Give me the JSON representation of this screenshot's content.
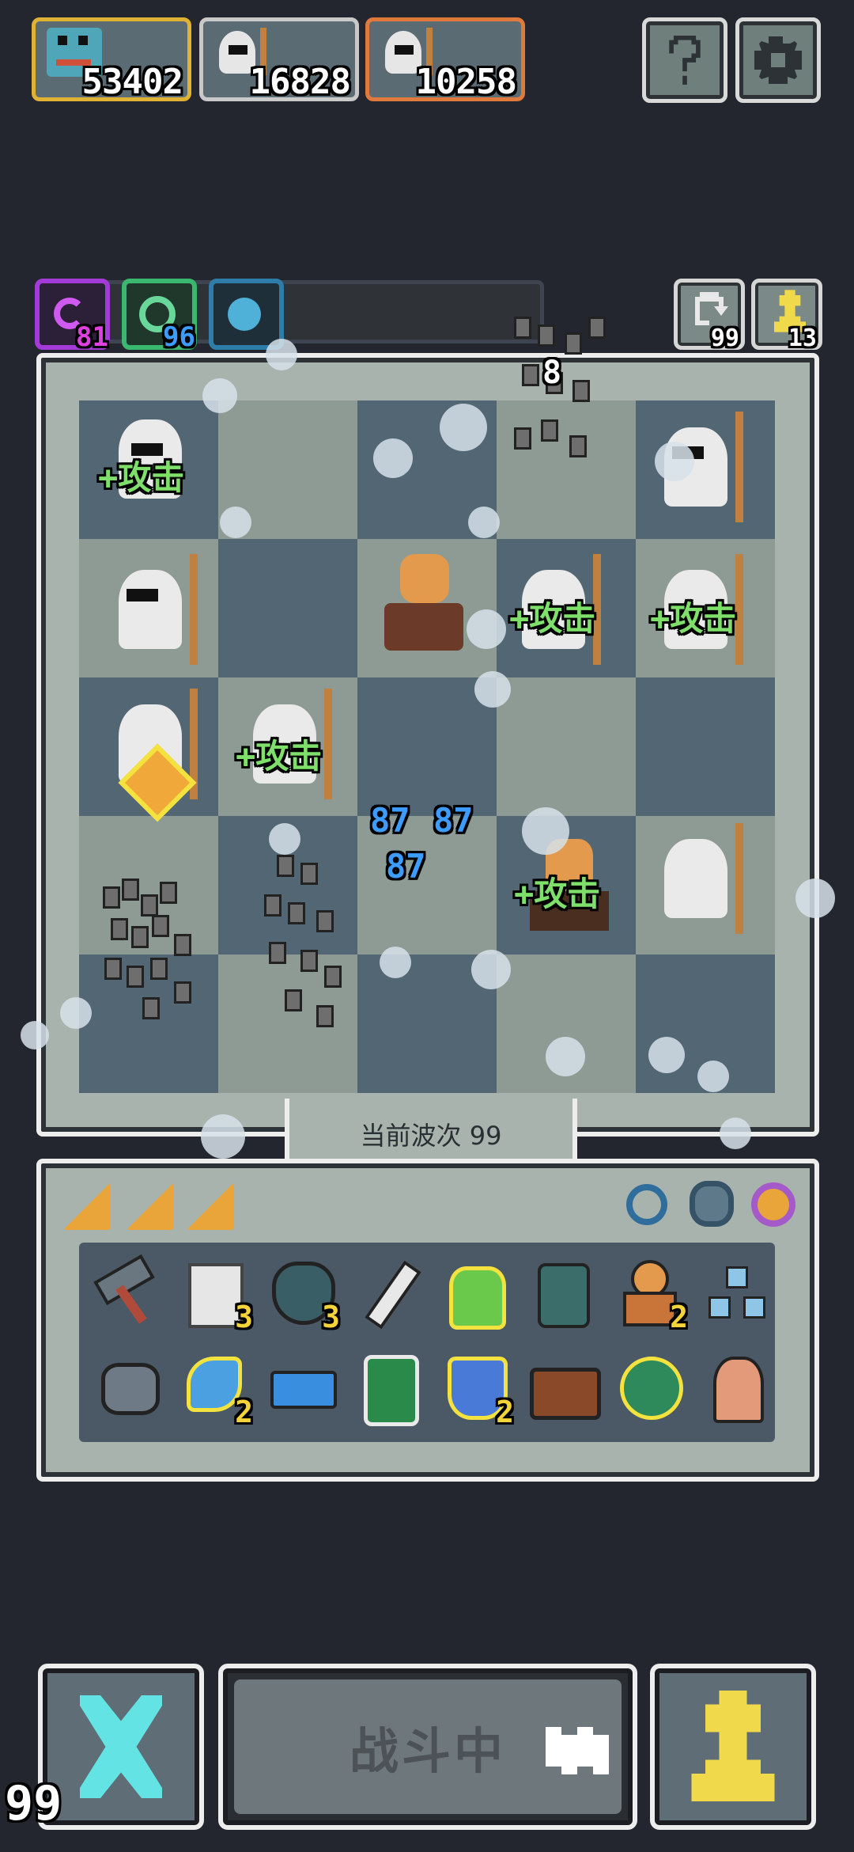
{
  "scores": [
    {
      "name": "player-score",
      "value": "53402",
      "border": "#e0b234"
    },
    {
      "name": "enemy-score-1",
      "value": "16828",
      "border": "#c9c9c9"
    },
    {
      "name": "enemy-score-2",
      "value": "10258",
      "border": "#e07a3c"
    }
  ],
  "top_buttons": {
    "help_icon": "question-mark",
    "settings_icon": "gear"
  },
  "charges": [
    {
      "color": "#a43bd8",
      "count": "81",
      "count_color": "#e040e0"
    },
    {
      "color": "#3ab870",
      "count": "96",
      "count_color": "#3c9cff"
    },
    {
      "color": "#2e7da8",
      "count": "",
      "count_color": "#3c9cff"
    }
  ],
  "resources": {
    "refresh_count": "99",
    "chess_count": "13"
  },
  "board": {
    "floating_number": "8",
    "buffs": {
      "attack_label": "+攻击"
    },
    "stack_number": "87",
    "wave_label": "当前波次 99"
  },
  "inventory": {
    "row1": [
      {
        "icon": "hammer-icon",
        "count": ""
      },
      {
        "icon": "scroll-icon",
        "count": "3"
      },
      {
        "icon": "heart-gem-icon",
        "count": "3"
      },
      {
        "icon": "dagger-icon",
        "count": ""
      },
      {
        "icon": "potion-icon",
        "count": ""
      },
      {
        "icon": "glove-icon",
        "count": ""
      },
      {
        "icon": "bust-icon",
        "count": "2"
      },
      {
        "icon": "network-icon",
        "count": ""
      }
    ],
    "row2": [
      {
        "icon": "ore-icon",
        "count": ""
      },
      {
        "icon": "axe-icon",
        "count": "2"
      },
      {
        "icon": "battery-icon",
        "count": ""
      },
      {
        "icon": "recycle-jar-icon",
        "count": ""
      },
      {
        "icon": "shield-icon",
        "count": "2"
      },
      {
        "icon": "chest-icon",
        "count": ""
      },
      {
        "icon": "orb-icon",
        "count": ""
      },
      {
        "icon": "tombstone-icon",
        "count": ""
      }
    ]
  },
  "bottom": {
    "fight_label": "战斗中",
    "corner_number": "99"
  }
}
